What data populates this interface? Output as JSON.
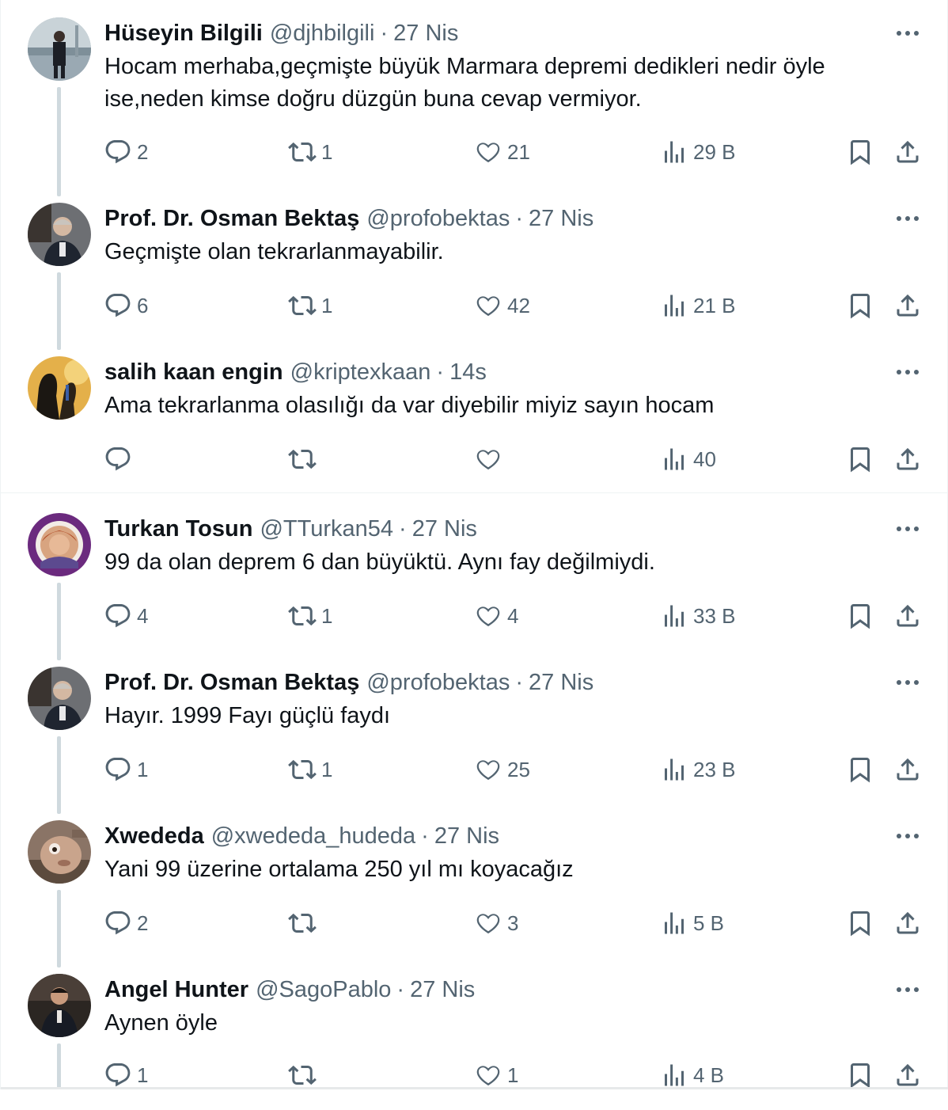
{
  "colors": {
    "text": "#0f1419",
    "secondary": "#536471",
    "thread_line": "#cfd9de",
    "divider": "#eff3f4"
  },
  "icons": {
    "reply": "speech-bubble-icon",
    "retweet": "retweet-arrows-icon",
    "like": "heart-icon",
    "views": "bar-chart-icon",
    "bookmark": "bookmark-icon",
    "share": "share-upload-icon",
    "more": "three-dots-icon"
  },
  "separator_char": "·",
  "tweets": [
    {
      "name": "Hüseyin Bilgili",
      "handle": "@djhbilgili",
      "date": "27 Nis",
      "text": "Hocam merhaba,geçmişte büyük Marmara depremi dedikleri nedir öyle ise,neden kimse doğru düzgün buna cevap vermiyor.",
      "replies": "2",
      "retweets": "1",
      "likes": "21",
      "views": "29 B"
    },
    {
      "name": "Prof. Dr. Osman Bektaş",
      "handle": "@profobektas",
      "date": "27 Nis",
      "text": "Geçmişte olan tekrarlanmayabilir.",
      "replies": "6",
      "retweets": "1",
      "likes": "42",
      "views": "21 B"
    },
    {
      "name": "salih kaan engin",
      "handle": "@kriptexkaan",
      "date": "14s",
      "text": "Ama tekrarlanma olasılığı da var diyebilir miyiz sayın hocam",
      "replies": "",
      "retweets": "",
      "likes": "",
      "views": "40"
    },
    {
      "name": "Turkan Tosun",
      "handle": "@TTurkan54",
      "date": "27 Nis",
      "text": "99 da olan deprem 6 dan büyüktü. Aynı fay değilmiydi.",
      "replies": "4",
      "retweets": "1",
      "likes": "4",
      "views": "33 B"
    },
    {
      "name": "Prof. Dr. Osman Bektaş",
      "handle": "@profobektas",
      "date": "27 Nis",
      "text": "Hayır. 1999 Fayı güçlü faydı",
      "replies": "1",
      "retweets": "1",
      "likes": "25",
      "views": "23 B"
    },
    {
      "name": "Xwededa",
      "handle": "@xwededa_hudeda",
      "date": "27 Nis",
      "text": "Yani 99 üzerine ortalama 250 yıl mı koyacağız",
      "replies": "2",
      "retweets": "",
      "likes": "3",
      "views": "5 B"
    },
    {
      "name": "Angel Hunter",
      "handle": "@SagoPablo",
      "date": "27 Nis",
      "text": "Aynen öyle",
      "replies": "1",
      "retweets": "",
      "likes": "1",
      "views": "4 B"
    }
  ]
}
